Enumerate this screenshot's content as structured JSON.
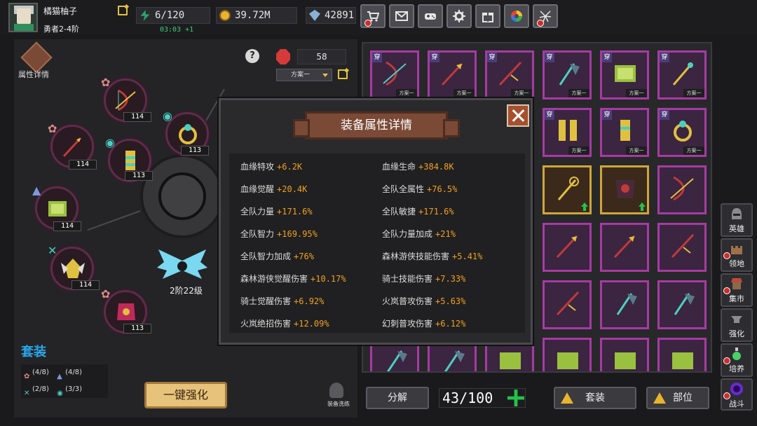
{
  "player": {
    "name": "橘猫柚子",
    "rank": "勇者2-4阶"
  },
  "resources": {
    "energy": "6/120",
    "timer": "03:03 +1",
    "gold": "39.72M",
    "gems": "42891"
  },
  "top_buttons": [
    {
      "name": "shop",
      "icon": "cart-icon",
      "badge": true
    },
    {
      "name": "mail",
      "icon": "envelope-icon",
      "badge": false
    },
    {
      "name": "gamepad",
      "icon": "gamepad-icon",
      "badge": false
    },
    {
      "name": "settings",
      "icon": "gear-icon",
      "badge": false
    },
    {
      "name": "gift",
      "icon": "gift-icon",
      "badge": false
    },
    {
      "name": "wheel",
      "icon": "color-wheel-icon",
      "badge": false
    },
    {
      "name": "event",
      "icon": "firework-icon",
      "badge": true
    }
  ],
  "left": {
    "attr_detail_label": "属性详情",
    "help": "?",
    "ruby_count": "58",
    "plan_select": "方案一",
    "slots": [
      {
        "level": "114"
      },
      {
        "level": "114"
      },
      {
        "level": "113"
      },
      {
        "level": "113"
      },
      {
        "level": "114"
      },
      {
        "level": "114"
      },
      {
        "level": "113"
      }
    ],
    "wings_label": "2阶22级",
    "set_title": "套装",
    "sets": [
      {
        "a": "(4/8)",
        "b": "(4/8)"
      },
      {
        "a": "(2/8)",
        "b": "(3/3)"
      }
    ],
    "one_key_button": "一键强化",
    "wash_label": "装备洗练"
  },
  "modal": {
    "title": "装备属性详情",
    "stats_left": [
      {
        "k": "血缘特攻",
        "v": "+6.2K"
      },
      {
        "k": "血缘觉醒",
        "v": "+20.4K"
      },
      {
        "k": "全队力量",
        "v": "+171.6%"
      },
      {
        "k": "全队智力",
        "v": "+169.95%"
      },
      {
        "k": "全队智力加成",
        "v": "+76%"
      },
      {
        "k": "森林游侠觉醒伤害",
        "v": "+10.17%"
      },
      {
        "k": "骑士觉醒伤害",
        "v": "+6.92%"
      },
      {
        "k": "火岚绝招伤害",
        "v": "+12.09%"
      }
    ],
    "stats_right": [
      {
        "k": "血缘生命",
        "v": "+384.8K"
      },
      {
        "k": "全队全属性",
        "v": "+76.5%"
      },
      {
        "k": "全队敏捷",
        "v": "+171.6%"
      },
      {
        "k": "全队力量加成",
        "v": "+21%"
      },
      {
        "k": "森林游侠技能伤害",
        "v": "+5.41%"
      },
      {
        "k": "骑士技能伤害",
        "v": "+7.33%"
      },
      {
        "k": "火岚普攻伤害",
        "v": "+5.63%"
      },
      {
        "k": "幻刺普攻伤害",
        "v": "+6.12%"
      }
    ]
  },
  "inventory": {
    "wear_mark": "穿",
    "plan_mark": "方案一",
    "capacity": "43/100"
  },
  "bottom": {
    "decompose": "分解",
    "set_sort": "套装",
    "slot_sort": "部位"
  },
  "nav": [
    {
      "label": "英雄",
      "badge": false
    },
    {
      "label": "领地",
      "badge": true
    },
    {
      "label": "集市",
      "badge": true
    },
    {
      "label": "强化",
      "badge": false
    },
    {
      "label": "培养",
      "badge": true
    },
    {
      "label": "战斗",
      "badge": true
    }
  ],
  "colors": {
    "accent_gold": "#f0a020",
    "set_blue": "#29a6e8",
    "rarity_purple": "#a73aa3",
    "rarity_gold": "#d0a63a",
    "energy_green": "#3fce72"
  }
}
